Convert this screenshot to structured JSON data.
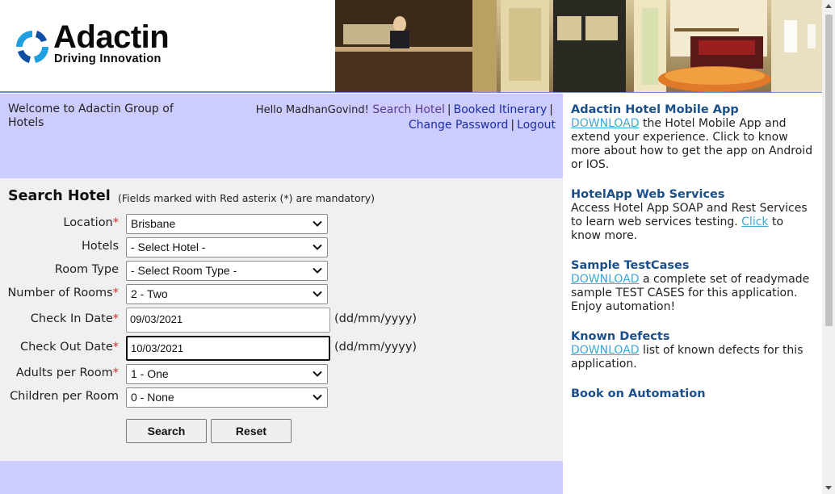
{
  "header": {
    "logo_title": "Adactin",
    "logo_subtitle": "Driving Innovation"
  },
  "welcome": {
    "text": "Welcome to Adactin Group of Hotels"
  },
  "user_nav": {
    "hello": "Hello MadhanGovind!",
    "search_hotel": "Search Hotel",
    "booked_itinerary": "Booked Itinerary",
    "change_password": "Change Password",
    "logout": "Logout",
    "separator": "|"
  },
  "search_form": {
    "title": "Search Hotel",
    "note": "(Fields marked with Red asterix (*) are mandatory)",
    "mandatory_marker": "*",
    "fields": {
      "location": {
        "label": "Location",
        "value": "Brisbane"
      },
      "hotels": {
        "label": "Hotels",
        "value": "- Select Hotel -"
      },
      "room_type": {
        "label": "Room Type",
        "value": "- Select Room Type -"
      },
      "rooms": {
        "label": "Number of Rooms",
        "value": "2 - Two"
      },
      "check_in": {
        "label": "Check In Date",
        "value": "09/03/2021"
      },
      "check_out": {
        "label": "Check Out Date",
        "value": "10/03/2021"
      },
      "adults": {
        "label": "Adults per Room",
        "value": "1 - One"
      },
      "children": {
        "label": "Children per Room",
        "value": "0 - None"
      }
    },
    "date_format": "(dd/mm/yyyy)",
    "search_button": "Search",
    "reset_button": "Reset"
  },
  "sidebar": {
    "mobile_app": {
      "title": "Adactin Hotel Mobile App",
      "link": "DOWNLOAD",
      "text": " the Hotel Mobile App and extend your experience. Click to know more about how to get the app on Android or IOS."
    },
    "web_services": {
      "title": "HotelApp Web Services",
      "text_before": "Access Hotel App SOAP and Rest Services to learn web services testing. ",
      "link": "Click",
      "text_after": " to know more."
    },
    "test_cases": {
      "title": "Sample TestCases",
      "link": "DOWNLOAD",
      "text": " a complete set of readymade sample TEST CASES for this application. Enjoy automation!"
    },
    "known_defects": {
      "title": "Known Defects",
      "link": "DOWNLOAD",
      "text": " list of known defects for this application."
    },
    "book": {
      "title": "Book on Automation"
    }
  },
  "colors": {
    "nav_band": "#ccccff",
    "panel": "#f0f0f0",
    "sidebar_title": "#1b4f8a",
    "sidebar_link": "#3da7dd",
    "mandatory": "#e0261f"
  },
  "icons": [
    "adactin-logo-icon",
    "chevron-down-icon",
    "scroll-up-icon",
    "scroll-down-icon"
  ]
}
